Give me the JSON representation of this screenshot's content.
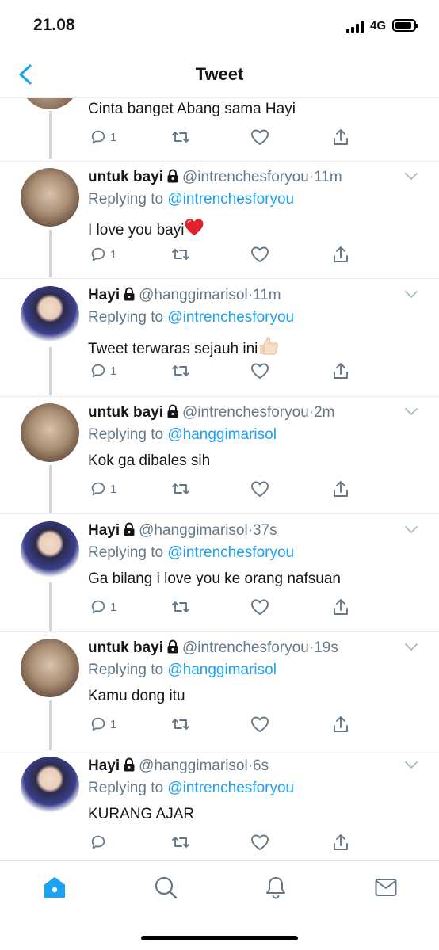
{
  "status_bar": {
    "time": "21.08",
    "network": "4G"
  },
  "nav": {
    "title": "Tweet"
  },
  "top_fragment": {
    "text": "Cinta banget Abang sama Hayi",
    "reply_count": "1"
  },
  "tweets": [
    {
      "name": "untuk bayi",
      "handle": "@intrenchesforyou",
      "time": "11m",
      "reply_prefix": "Replying to",
      "reply_to": "@intrenchesforyou",
      "text": "I love you bayi",
      "reply_count": "1"
    },
    {
      "name": "Hayi",
      "handle": "@hanggimarisol",
      "time": "11m",
      "reply_prefix": "Replying to",
      "reply_to": "@intrenchesforyou",
      "text": "Tweet terwaras sejauh ini",
      "reply_count": "1"
    },
    {
      "name": "untuk bayi",
      "handle": "@intrenchesforyou",
      "time": "2m",
      "reply_prefix": "Replying to",
      "reply_to": "@hanggimarisol",
      "text": "Kok ga dibales sih",
      "reply_count": "1"
    },
    {
      "name": "Hayi",
      "handle": "@hanggimarisol",
      "time": "37s",
      "reply_prefix": "Replying to",
      "reply_to": "@intrenchesforyou",
      "text": "Ga bilang i love you ke orang nafsuan",
      "reply_count": "1"
    },
    {
      "name": "untuk bayi",
      "handle": "@intrenchesforyou",
      "time": "19s",
      "reply_prefix": "Replying to",
      "reply_to": "@hanggimarisol",
      "text": "Kamu dong itu",
      "reply_count": "1"
    },
    {
      "name": "Hayi",
      "handle": "@hanggimarisol",
      "time": "6s",
      "reply_prefix": "Replying to",
      "reply_to": "@intrenchesforyou",
      "text": "KURANG AJAR",
      "reply_count": ""
    }
  ],
  "meta_separator": "·",
  "icons": {
    "back": "chevron-left-icon",
    "lock": "lock-icon",
    "reply": "reply-icon",
    "retweet": "retweet-icon",
    "like": "heart-icon",
    "share": "share-icon",
    "home": "home-icon",
    "search": "search-icon",
    "notifications": "bell-icon",
    "messages": "mail-icon",
    "heart_emoji": "red-heart-emoji",
    "thumbs_up_emoji": "thumbs-up-emoji"
  },
  "colors": {
    "accent": "#1da1f2",
    "secondary_text": "#657786",
    "primary_text": "#14171a",
    "divider": "#e6ecf0",
    "thread_line": "#ccd6dd"
  }
}
